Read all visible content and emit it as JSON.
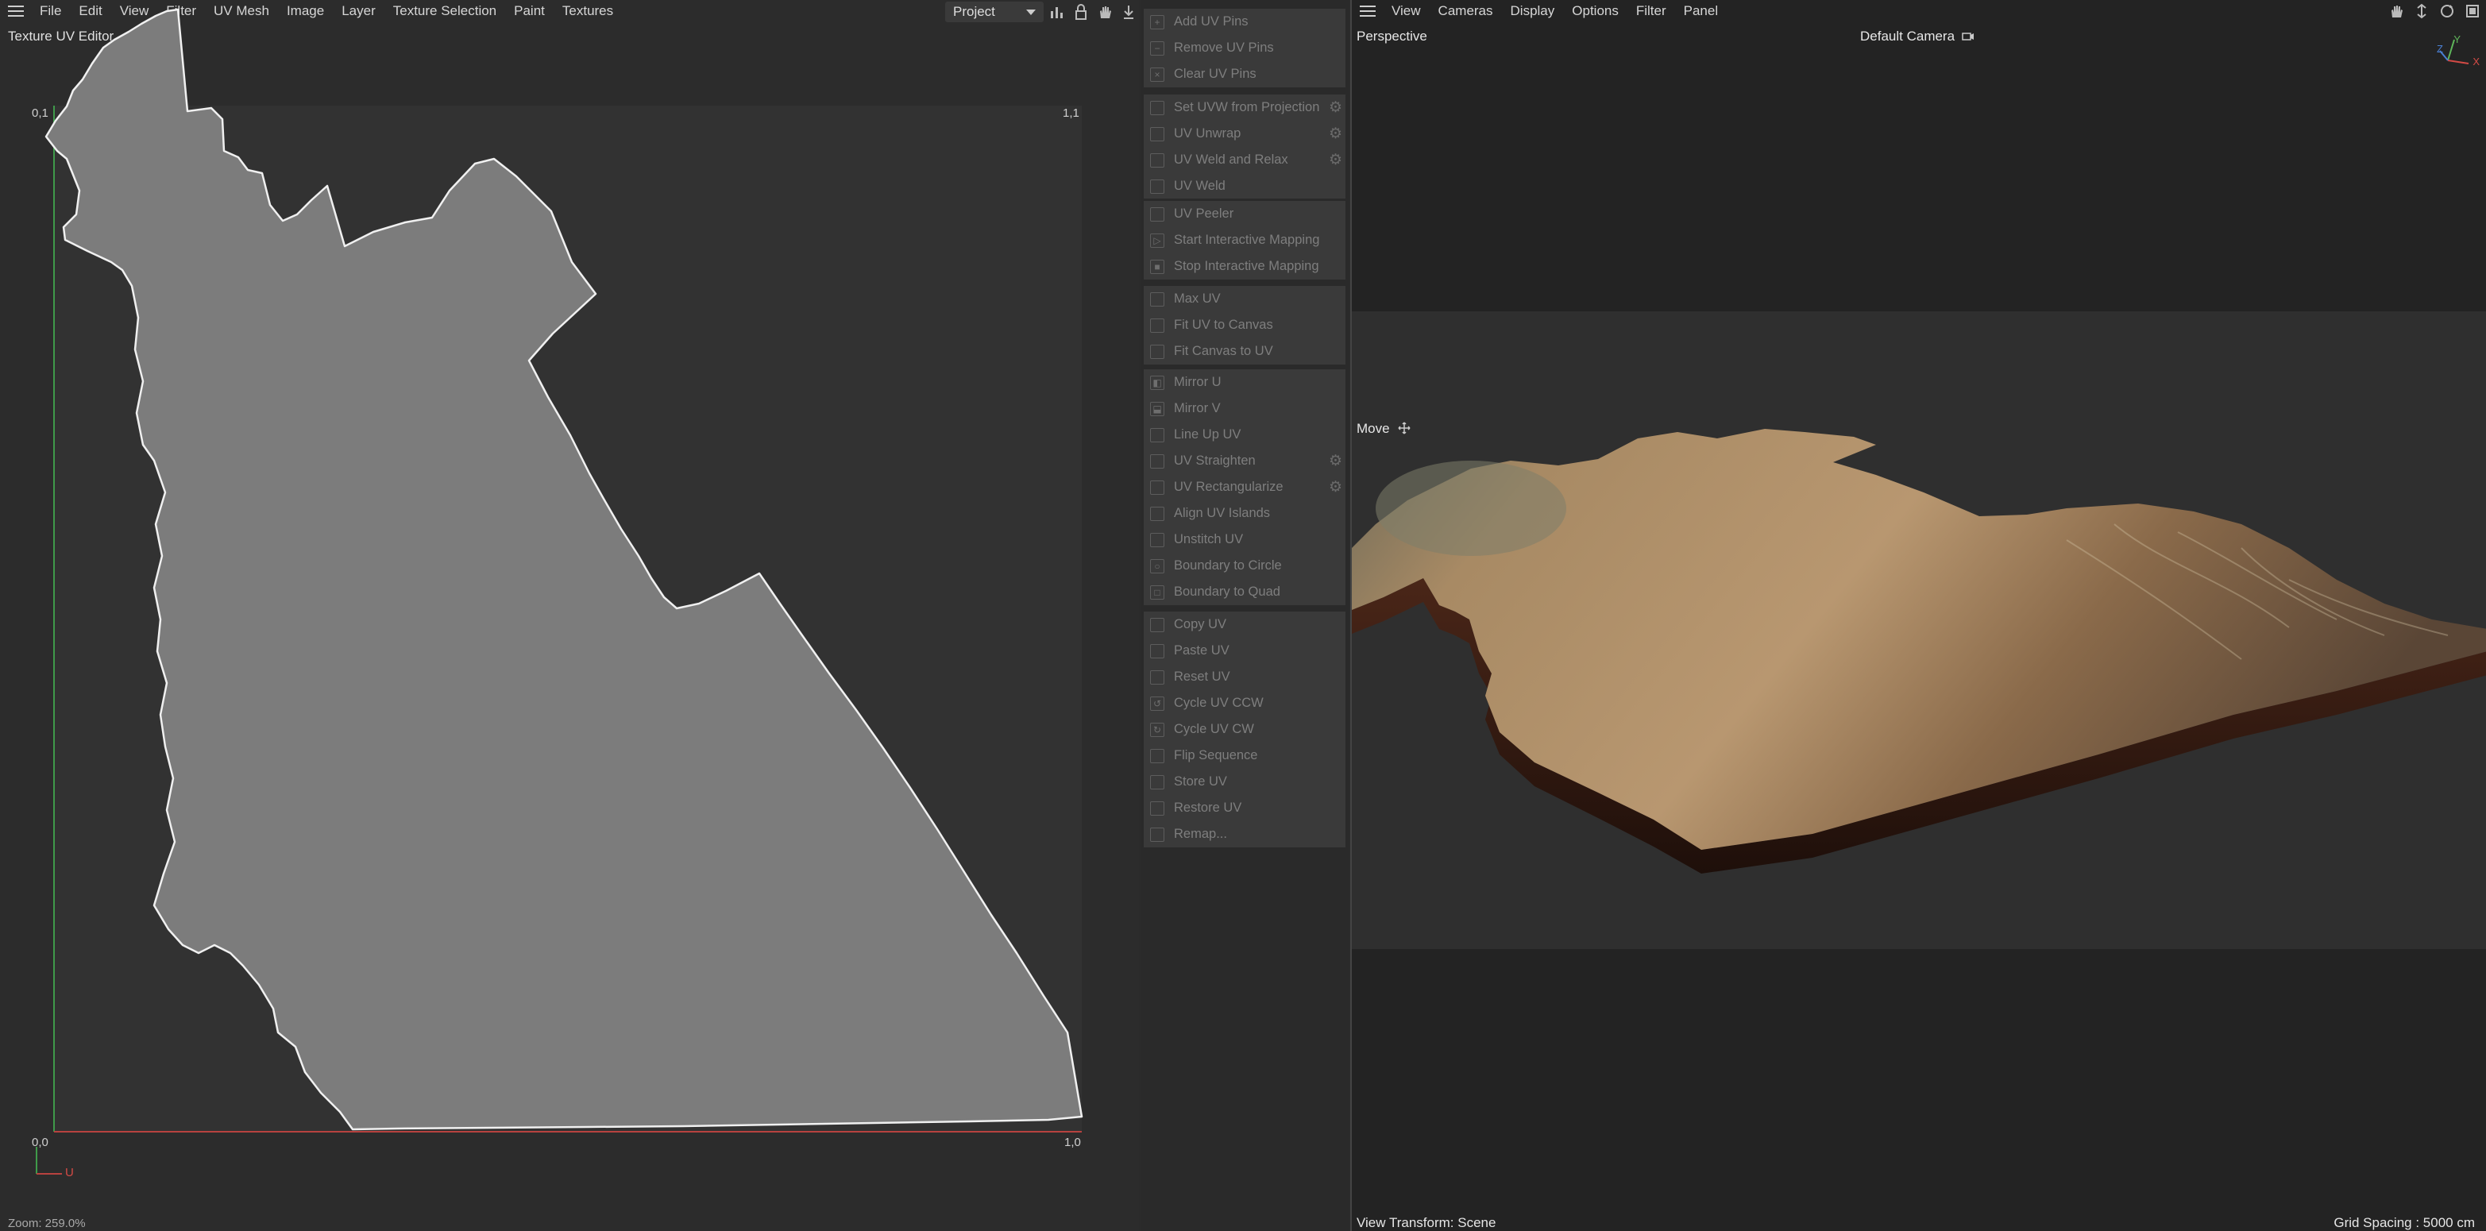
{
  "uv_editor": {
    "menu": [
      "File",
      "Edit",
      "View",
      "Filter",
      "UV Mesh",
      "Image",
      "Layer",
      "Texture Selection",
      "Paint",
      "Textures"
    ],
    "title": "Texture UV Editor",
    "project_select": "Project",
    "corners": {
      "top_left": "0,1",
      "top_right": "1,1",
      "bottom_left": "0,0",
      "bottom_right": "1,0"
    },
    "axis_u": "U",
    "zoom": "Zoom: 259.0%"
  },
  "commands": {
    "groups": [
      [
        {
          "label": "Add UV Pins",
          "icon": "pin-add-icon"
        },
        {
          "label": "Remove UV Pins",
          "icon": "pin-remove-icon"
        },
        {
          "label": "Clear UV Pins",
          "icon": "clear-icon"
        }
      ],
      [
        {
          "label": "Set UVW from Projection",
          "icon": "projection-icon",
          "gear": true
        },
        {
          "label": "UV Unwrap",
          "icon": "unwrap-icon",
          "gear": true
        },
        {
          "label": "UV Weld and Relax",
          "icon": "relax-icon",
          "gear": true
        },
        {
          "label": "UV Weld",
          "icon": "weld-icon"
        }
      ],
      [
        {
          "label": "UV Peeler",
          "icon": "peeler-icon"
        },
        {
          "label": "Start Interactive Mapping",
          "icon": "play-icon"
        },
        {
          "label": "Stop Interactive Mapping",
          "icon": "stop-icon"
        }
      ],
      [
        {
          "label": "Max UV",
          "icon": "max-icon"
        },
        {
          "label": "Fit UV to Canvas",
          "icon": "fit-icon"
        },
        {
          "label": "Fit Canvas to UV",
          "icon": "fit-canvas-icon"
        }
      ],
      [
        {
          "label": "Mirror U",
          "icon": "mirror-u-icon"
        },
        {
          "label": "Mirror V",
          "icon": "mirror-v-icon"
        },
        {
          "label": "Line Up UV",
          "icon": "lineup-icon"
        },
        {
          "label": "UV Straighten",
          "icon": "straighten-icon",
          "gear": true
        },
        {
          "label": "UV Rectangularize",
          "icon": "rect-icon",
          "gear": true
        },
        {
          "label": "Align UV Islands",
          "icon": "align-icon"
        },
        {
          "label": "Unstitch UV",
          "icon": "unstitch-icon"
        },
        {
          "label": "Boundary to Circle",
          "icon": "circle-icon"
        },
        {
          "label": "Boundary to Quad",
          "icon": "quad-icon"
        }
      ],
      [
        {
          "label": "Copy UV",
          "icon": "copy-icon"
        },
        {
          "label": "Paste UV",
          "icon": "paste-icon"
        },
        {
          "label": "Reset UV",
          "icon": "reset-icon"
        },
        {
          "label": "Cycle UV CCW",
          "icon": "ccw-icon"
        },
        {
          "label": "Cycle UV CW",
          "icon": "cw-icon"
        },
        {
          "label": "Flip Sequence",
          "icon": "flip-icon"
        },
        {
          "label": "Store UV",
          "icon": "store-icon"
        },
        {
          "label": "Restore UV",
          "icon": "restore-icon"
        },
        {
          "label": "Remap...",
          "icon": "remap-icon"
        }
      ]
    ]
  },
  "viewport": {
    "menu": [
      "View",
      "Cameras",
      "Display",
      "Options",
      "Filter",
      "Panel"
    ],
    "view_name": "Perspective",
    "camera": "Default Camera",
    "tool": "Move",
    "view_transform": "View Transform: Scene",
    "grid_spacing": "Grid Spacing : 5000 cm",
    "axis_labels": {
      "y": "Y",
      "z": "Z",
      "x": "X"
    }
  }
}
